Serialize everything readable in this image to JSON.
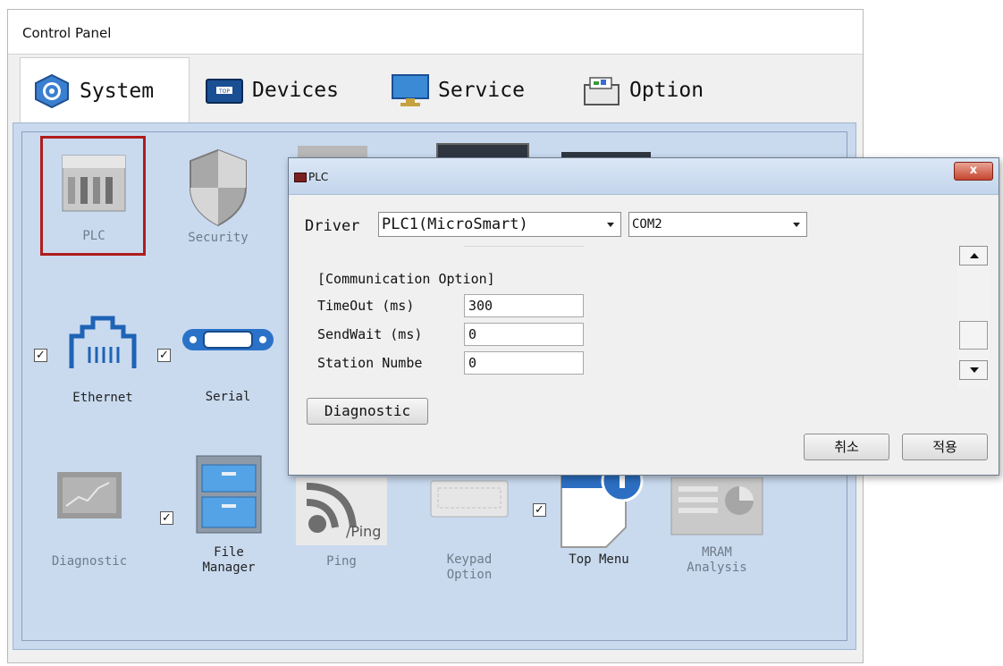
{
  "control_panel": {
    "title": "Control Panel",
    "tabs": [
      {
        "label": "System",
        "icon": "gear-icon",
        "active": true
      },
      {
        "label": "Devices",
        "icon": "top-display-icon",
        "active": false
      },
      {
        "label": "Service",
        "icon": "vnc-ftp-monitor-icon",
        "active": false
      },
      {
        "label": "Option",
        "icon": "drawer-icon",
        "active": false
      }
    ],
    "items": {
      "plc": "PLC",
      "security": "Security",
      "ethernet": "Ethernet",
      "serial": "Serial",
      "diagnostic": "Diagnostic",
      "file_manager_1": "File",
      "file_manager_2": "Manager",
      "ping": "Ping",
      "ping_icon_text": "/Ping",
      "keypad_1": "Keypad",
      "keypad_2": "Option",
      "top_menu": "Top Menu",
      "mram_1": "MRAM",
      "mram_2": "Analysis"
    },
    "checkboxes": {
      "ethernet": true,
      "serial": true,
      "file_manager": true,
      "top_menu": true
    }
  },
  "plc_dialog": {
    "title": "PLC",
    "driver_label": "Driver",
    "driver_value": "PLC1(MicroSmart)",
    "port_value": "COM2",
    "section_header": "[Communication Option]",
    "fields": [
      {
        "label": "TimeOut (ms)",
        "value": "300"
      },
      {
        "label": "SendWait (ms)",
        "value": "0"
      },
      {
        "label": "Station Numbe",
        "value": "0"
      }
    ],
    "diagnostic_button": "Diagnostic",
    "cancel_button": "취소",
    "apply_button": "적용",
    "close_glyph": "x"
  },
  "colors": {
    "selection_border": "#b01c1c",
    "panel_bg": "#c9daef",
    "dialog_title_bg": "#c3d5ec"
  }
}
